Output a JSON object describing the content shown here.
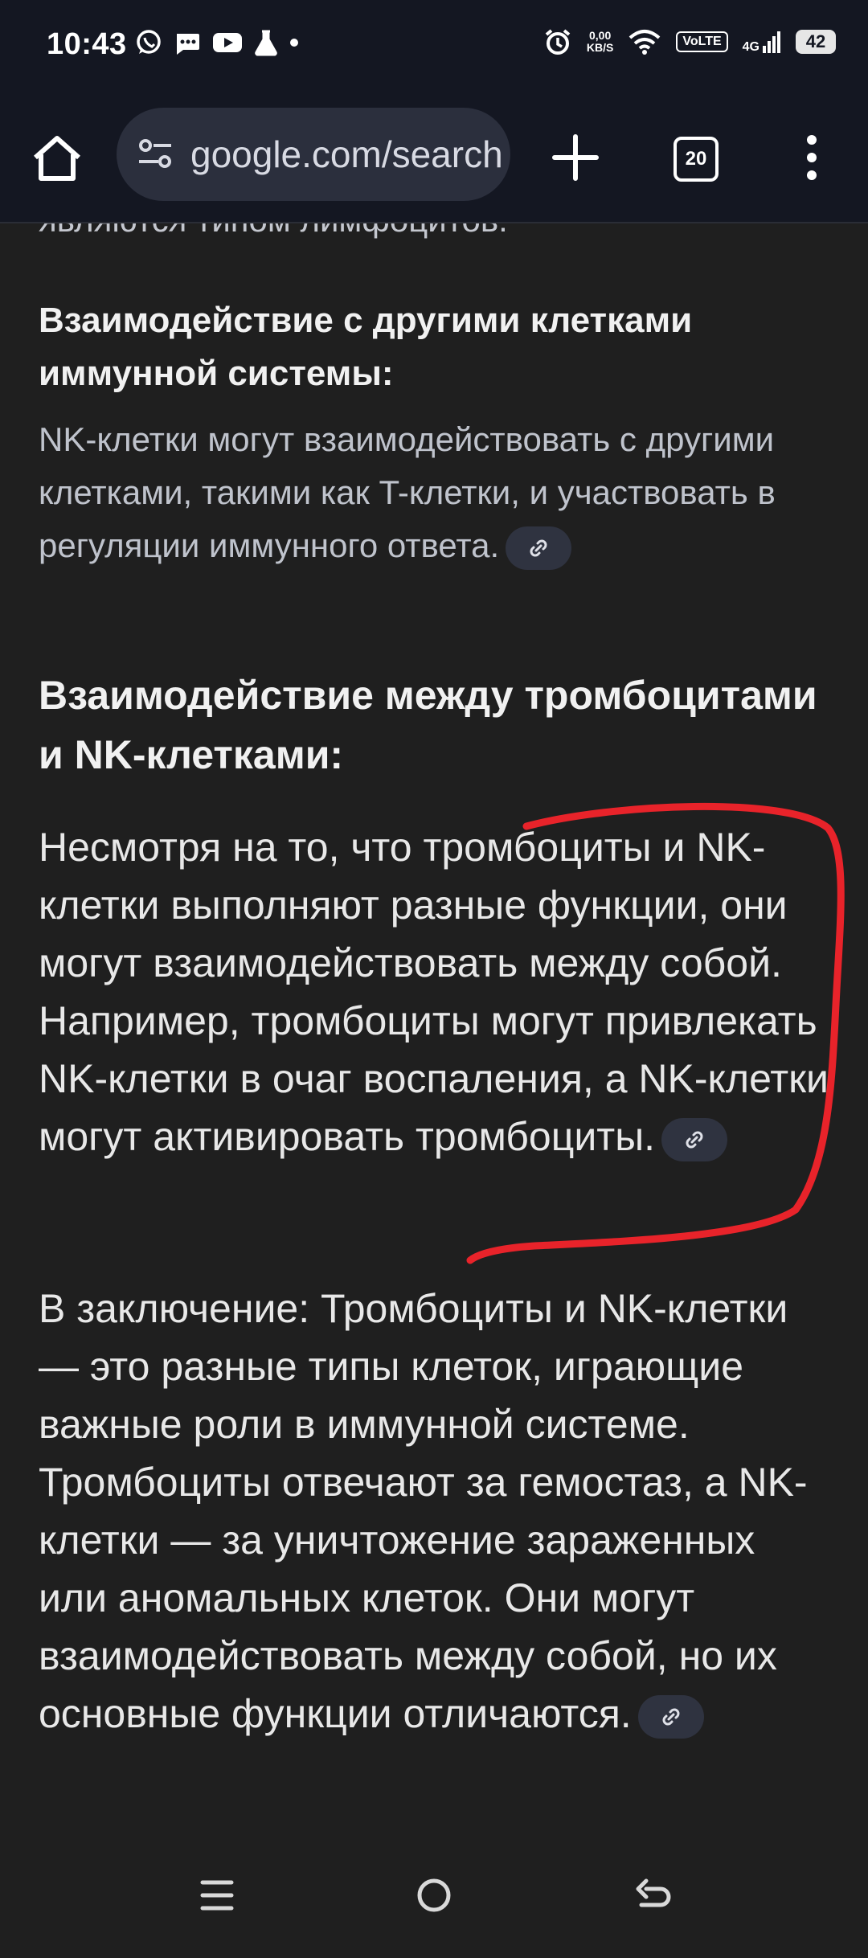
{
  "status_bar": {
    "time": "10:43",
    "net_speed_value": "0,00",
    "net_speed_unit": "KB/S",
    "volte": "VoLTE",
    "network": "4G",
    "battery": "42"
  },
  "toolbar": {
    "url": "google.com/search",
    "tab_count": "20"
  },
  "content": {
    "clipped_line": "являются типом лимфоцитов.",
    "subheading": "Взаимодействие с другими клетками иммунной системы:",
    "subheading_text": "NK-клетки могут взаимодействовать с другими клетками, такими как T-клетки, и участвовать в регуляции иммунного ответа.",
    "section_heading": "Взаимодействие между тромбоцитами и NK-клетками:",
    "paragraph1": "Несмотря на то, что тромбоциты и NK-клетки выполняют разные функции, они могут взаимодействовать между собой. Например, тромбоциты могут привлекать NK-клетки в очаг воспаления, а NK-клетки могут активировать тромбоциты.",
    "paragraph2": "В заключение: Тромбоциты и NK-клетки — это разные типы клеток, играющие важные роли в иммунной системе. Тромбоциты отвечают за гемостаз, а NK-клетки — за уничтожение зараженных или аномальных клеток. Они могут взаимодействовать между собой, но их основные функции отличаются."
  },
  "colors": {
    "page_background": "#1f1f1f",
    "toolbar_background": "#141722",
    "annotation": "#e8232a"
  },
  "icons": [
    "whatsapp-icon",
    "messages-icon",
    "youtube-icon",
    "flask-icon",
    "alarm-icon",
    "wifi-icon",
    "signal-icon",
    "home-icon",
    "site-settings-icon",
    "plus-icon",
    "tabs-icon",
    "more-vert-icon",
    "link-icon",
    "recents-icon",
    "home-circle-icon",
    "back-icon"
  ]
}
